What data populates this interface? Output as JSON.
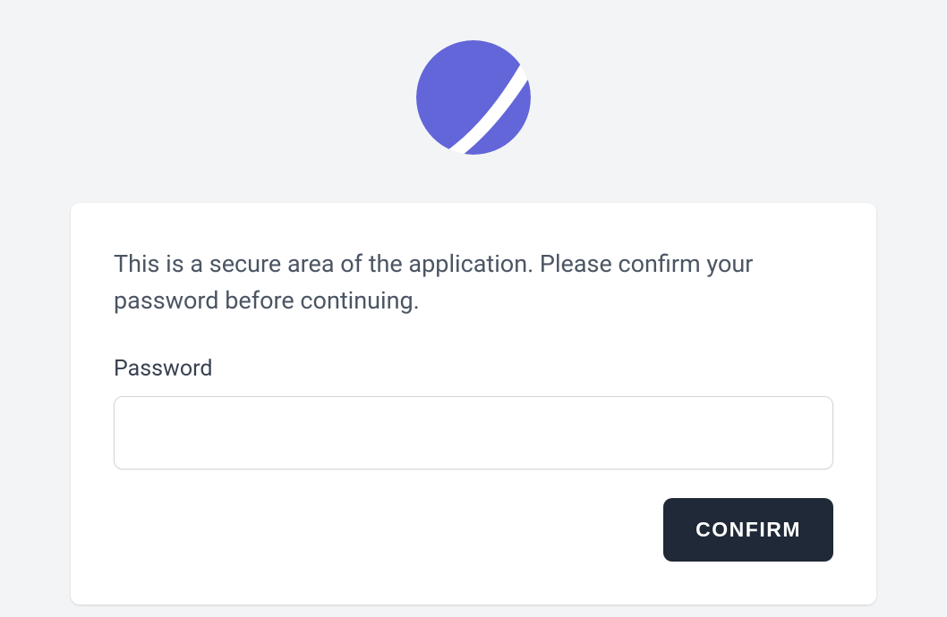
{
  "message": "This is a secure area of the application. Please confirm your password before continuing.",
  "form": {
    "password_label": "Password",
    "password_value": "",
    "confirm_label": "CONFIRM"
  },
  "colors": {
    "logo": "#6366d8",
    "button_bg": "#1f2937",
    "page_bg": "#f3f4f6"
  }
}
